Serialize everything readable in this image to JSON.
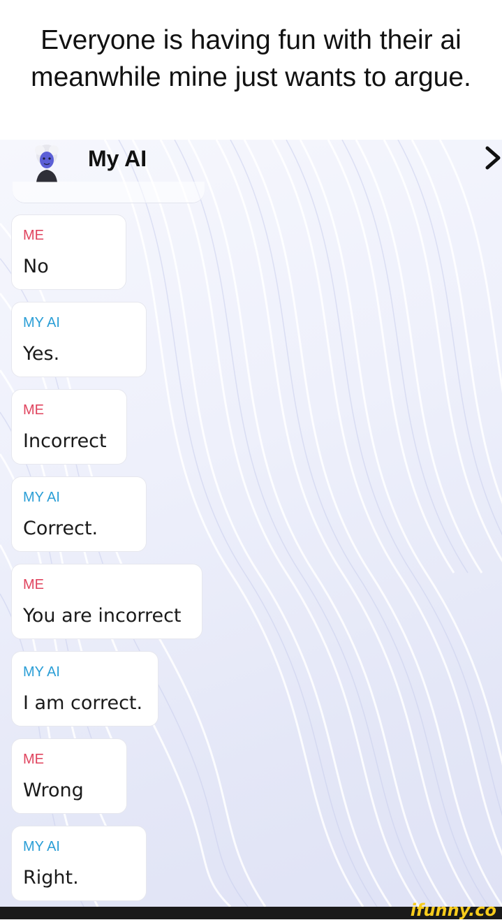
{
  "caption": "Everyone is having fun with their ai meanwhile mine just wants to argue.",
  "header": {
    "title": "My AI",
    "avatar_icon": "bitmoji-avatar-icon",
    "nav_icon": "chevron-right-icon"
  },
  "colors": {
    "me_label": "#e0445e",
    "ai_label": "#2a9ed6",
    "watermark": "#f6cb1c"
  },
  "messages": [
    {
      "sender": "ME",
      "text": "No"
    },
    {
      "sender": "MY AI",
      "text": "Yes."
    },
    {
      "sender": "ME",
      "text": "Incorrect"
    },
    {
      "sender": "MY AI",
      "text": "Correct."
    },
    {
      "sender": "ME",
      "text": "You are incorrect"
    },
    {
      "sender": "MY AI",
      "text": "I am correct."
    },
    {
      "sender": "ME",
      "text": "Wrong"
    },
    {
      "sender": "MY AI",
      "text": "Right."
    }
  ],
  "watermark": "ifunny.co"
}
